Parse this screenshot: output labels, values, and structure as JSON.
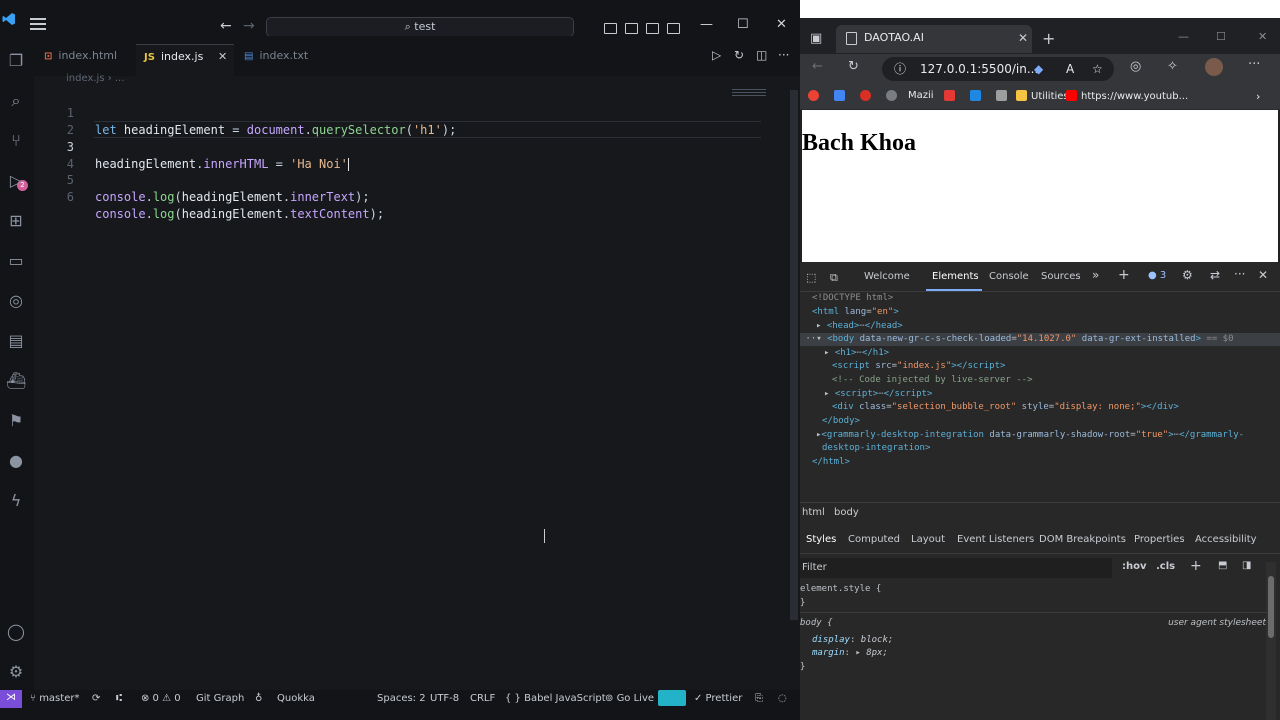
{
  "vscode": {
    "search_text": "test",
    "tabs": [
      {
        "label": "index.html",
        "icon": "html-file-icon",
        "active": false
      },
      {
        "label": "index.js",
        "icon": "js-file-icon",
        "active": true
      },
      {
        "label": "index.txt",
        "icon": "txt-file-icon",
        "active": false
      }
    ],
    "breadcrumb": "index.js › ...",
    "line_numbers": [
      "1",
      "2",
      "3",
      "4",
      "5",
      "6"
    ],
    "code": {
      "l1_kw": "let",
      "l1_var": "headingElement",
      "l1_eq": " = ",
      "l1_obj": "document",
      "l1_dot": ".",
      "l1_fn": "querySelector",
      "l1_open": "(",
      "l1_str": "'h1'",
      "l1_close": ");",
      "l3_var": "headingElement",
      "l3_dot": ".",
      "l3_prop": "innerHTML",
      "l3_eq": " = ",
      "l3_str": "'Ha Noi'",
      "l5_obj": "console",
      "l5_dot": ".",
      "l5_fn": "log",
      "l5_open": "(",
      "l5_arg": "headingElement",
      "l5_dot2": ".",
      "l5_prop": "innerText",
      "l5_close": ");",
      "l6_obj": "console",
      "l6_dot": ".",
      "l6_fn": "log",
      "l6_open": "(",
      "l6_arg": "headingElement",
      "l6_dot2": ".",
      "l6_prop": "textContent",
      "l6_close": ");"
    },
    "status": {
      "branch": "master*",
      "problems": "⊗ 0 ⚠ 0",
      "git_graph": "Git Graph",
      "quokka": "Quokka",
      "spaces": "Spaces: 2",
      "encoding": "UTF-8",
      "eol": "CRLF",
      "language": "{ } Babel JavaScript",
      "go_live": "Go Live",
      "prettier": "✓ Prettier"
    }
  },
  "browser": {
    "tab_title": "DAOTAO.AI",
    "url": "127.0.0.1:5500/in...",
    "bookmarks": {
      "mazii": "Mazii",
      "utilities": "Utilities",
      "youtube": "https://www.youtub..."
    },
    "page_heading": "Bach Khoa",
    "devtools": {
      "tabs": [
        "Welcome",
        "Elements",
        "Console",
        "Sources"
      ],
      "issues_count": "3",
      "crumbs": [
        "html",
        "body"
      ],
      "style_tabs": [
        "Styles",
        "Computed",
        "Layout",
        "Event Listeners",
        "DOM Breakpoints",
        "Properties",
        "Accessibility"
      ],
      "filter_placeholder": "Filter",
      "hov": ":hov",
      "cls": ".cls",
      "element_style": "element.style {",
      "body_selector": "body {",
      "ua_label": "user agent stylesheet",
      "display_prop": "display",
      "display_val": "block;",
      "margin_prop": "margin",
      "margin_val": "8px;"
    }
  }
}
